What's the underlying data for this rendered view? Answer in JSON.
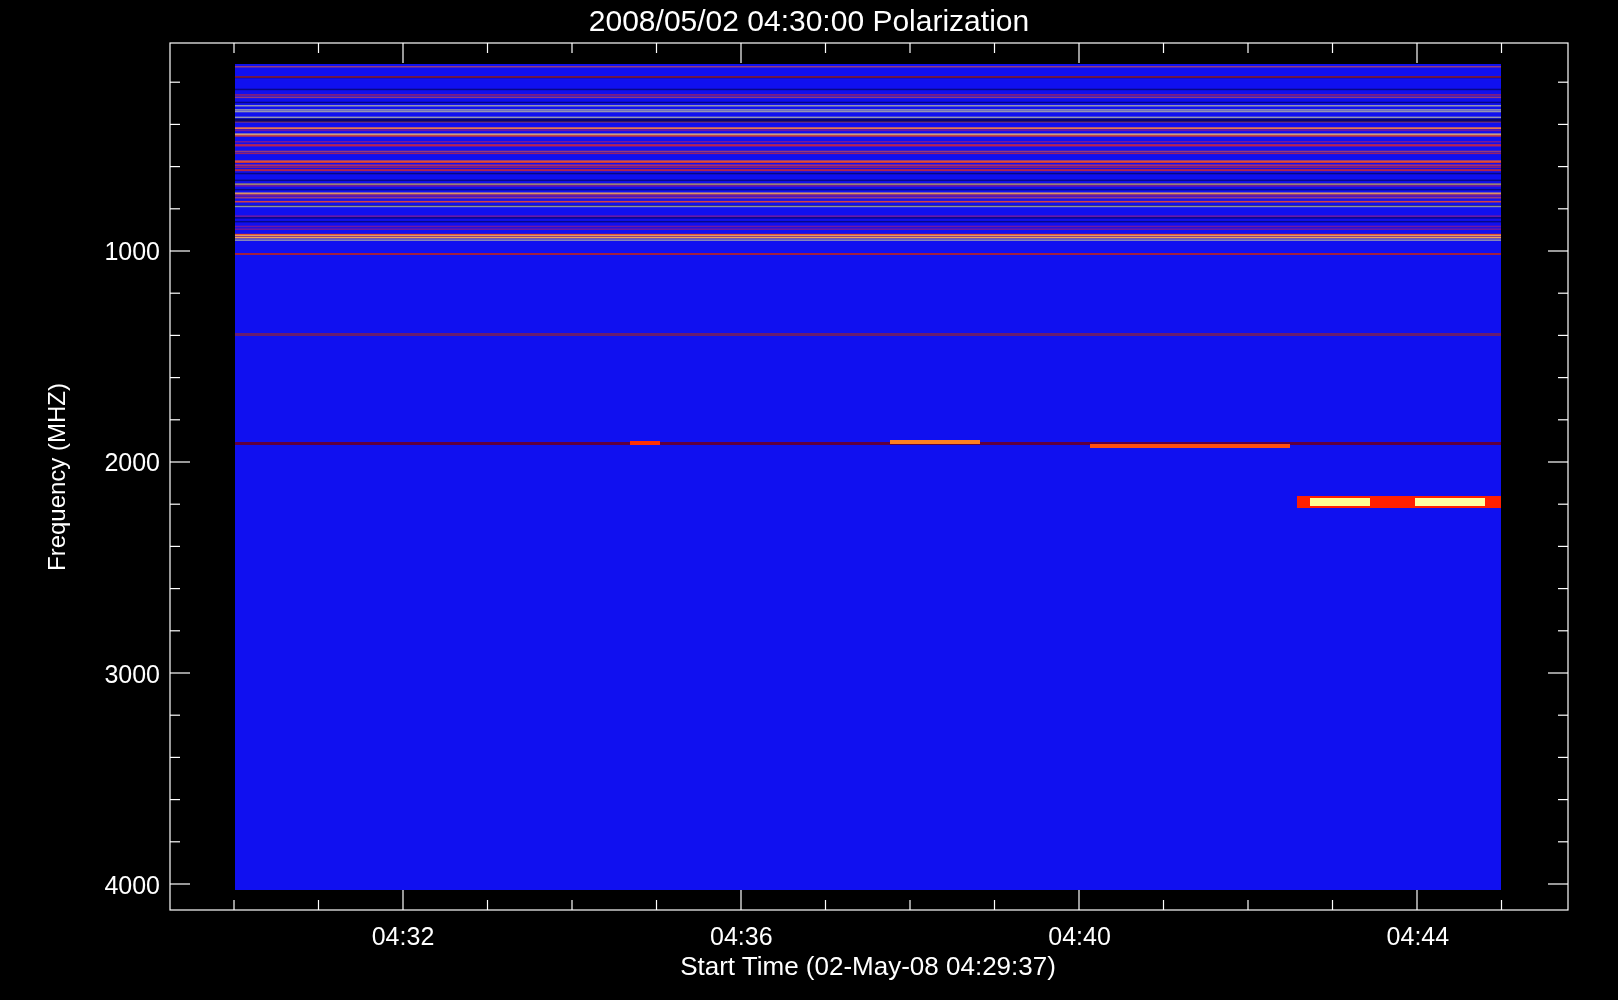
{
  "title": "2008/05/02 04:30:00 Polarization",
  "y_axis": {
    "label": "Frequency (MHZ)",
    "ticks": [
      "1000",
      "2000",
      "3000",
      "4000"
    ]
  },
  "x_axis": {
    "label": "Start Time (02-May-08 04:29:37)",
    "ticks": [
      "04:32",
      "04:36",
      "04:40",
      "04:44"
    ]
  }
}
